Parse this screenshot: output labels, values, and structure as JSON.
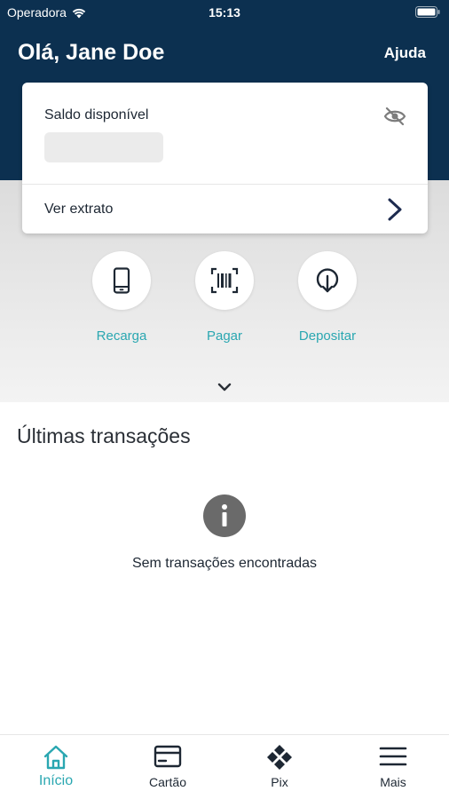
{
  "status_bar": {
    "carrier": "Operadora",
    "time": "15:13"
  },
  "header": {
    "greeting": "Olá, Jane Doe",
    "help": "Ajuda"
  },
  "balance_card": {
    "label": "Saldo disponível",
    "statement_link": "Ver extrato"
  },
  "actions": [
    {
      "label": "Recarga",
      "icon": "smartphone-icon"
    },
    {
      "label": "Pagar",
      "icon": "barcode-icon"
    },
    {
      "label": "Depositar",
      "icon": "download-icon"
    }
  ],
  "transactions": {
    "title": "Últimas transações",
    "empty_message": "Sem transações encontradas"
  },
  "tabbar": {
    "tabs": [
      {
        "label": "Início",
        "icon": "home-icon",
        "active": true
      },
      {
        "label": "Cartão",
        "icon": "card-icon",
        "active": false
      },
      {
        "label": "Pix",
        "icon": "pix-icon",
        "active": false
      },
      {
        "label": "Mais",
        "icon": "menu-icon",
        "active": false
      }
    ]
  },
  "colors": {
    "header_bg": "#0c3050",
    "accent": "#2aa7b1",
    "text": "#1d2733"
  }
}
